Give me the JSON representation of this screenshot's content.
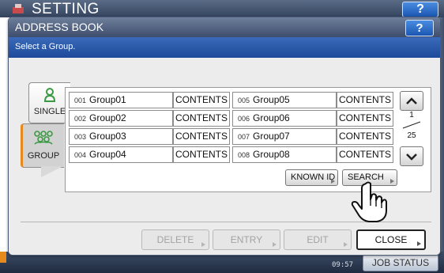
{
  "background": {
    "title": "SETTING",
    "help": "?",
    "clock": "09:57",
    "job_status": "JOB STATUS"
  },
  "dialog": {
    "title": "ADDRESS BOOK",
    "help": "?",
    "message": "Select a Group.",
    "tabs": [
      {
        "label": "SINGLE",
        "icon": "person-icon",
        "selected": false
      },
      {
        "label": "GROUP",
        "icon": "group-icon",
        "selected": true
      }
    ],
    "groups": [
      {
        "num": "001",
        "name": "Group01",
        "action": "CONTENTS"
      },
      {
        "num": "002",
        "name": "Group02",
        "action": "CONTENTS"
      },
      {
        "num": "003",
        "name": "Group03",
        "action": "CONTENTS"
      },
      {
        "num": "004",
        "name": "Group04",
        "action": "CONTENTS"
      },
      {
        "num": "005",
        "name": "Group05",
        "action": "CONTENTS"
      },
      {
        "num": "006",
        "name": "Group06",
        "action": "CONTENTS"
      },
      {
        "num": "007",
        "name": "Group07",
        "action": "CONTENTS"
      },
      {
        "num": "008",
        "name": "Group08",
        "action": "CONTENTS"
      }
    ],
    "known_id": "KNOWN ID",
    "search": "SEARCH",
    "page": {
      "current": "1",
      "total": "25"
    },
    "buttons": {
      "delete": "DELETE",
      "entry": "ENTRY",
      "edit": "EDIT",
      "close": "CLOSE"
    }
  },
  "colors": {
    "header": "#3d4d6b",
    "subheader": "#1d4a9a",
    "accent_orange": "#e68a1e"
  }
}
